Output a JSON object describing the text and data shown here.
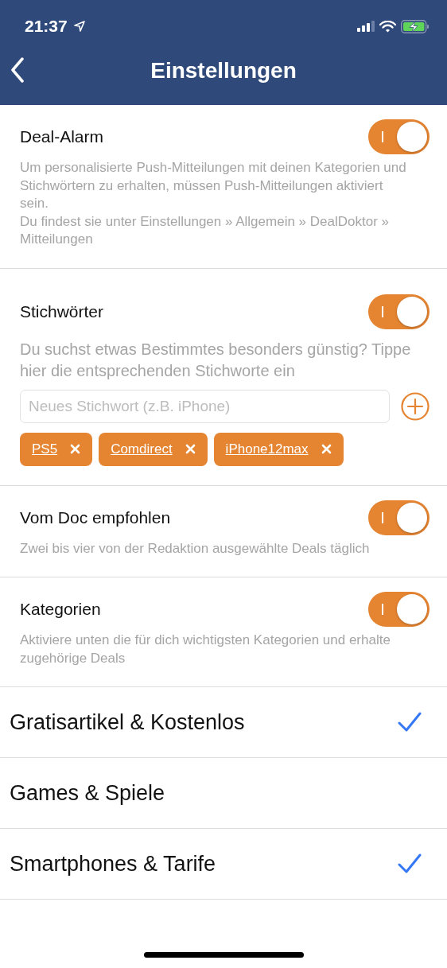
{
  "status_bar": {
    "time": "21:37"
  },
  "nav": {
    "title": "Einstellungen"
  },
  "sections": [
    {
      "kind": "plain",
      "title": "Deal-Alarm",
      "on": true,
      "description": "Um personalisierte Push-Mitteilungen mit deinen Kategorien und Stichwörtern zu erhalten, müssen Push-Mitteilungen aktiviert sein.\nDu findest sie unter Einstellungen » Allgemein » DealDoktor » Mitteilungen"
    },
    {
      "kind": "keywords",
      "title": "Stichwörter",
      "on": true,
      "description": "Du suchst etwas Bestimmtes besonders günstig? Tippe hier die entsprechenden Stichworte ein",
      "placeholder": "Neues Stichwort (z.B. iPhone)",
      "tags": [
        "PS5",
        "Comdirect",
        "iPhone12max"
      ]
    },
    {
      "kind": "plain",
      "title": "Vom Doc empfohlen",
      "on": true,
      "description": "Zwei bis vier von der Redaktion ausgewählte Deals täglich"
    },
    {
      "kind": "plain",
      "title": "Kategorien",
      "on": true,
      "description": "Aktiviere unten die für dich wichtigsten Kategorien und erhalte zugehörige Deals"
    }
  ],
  "categories": [
    {
      "label": "Gratisartikel & Kostenlos",
      "checked": true
    },
    {
      "label": "Games & Spiele",
      "checked": false
    },
    {
      "label": "Smartphones & Tarife",
      "checked": true
    }
  ]
}
